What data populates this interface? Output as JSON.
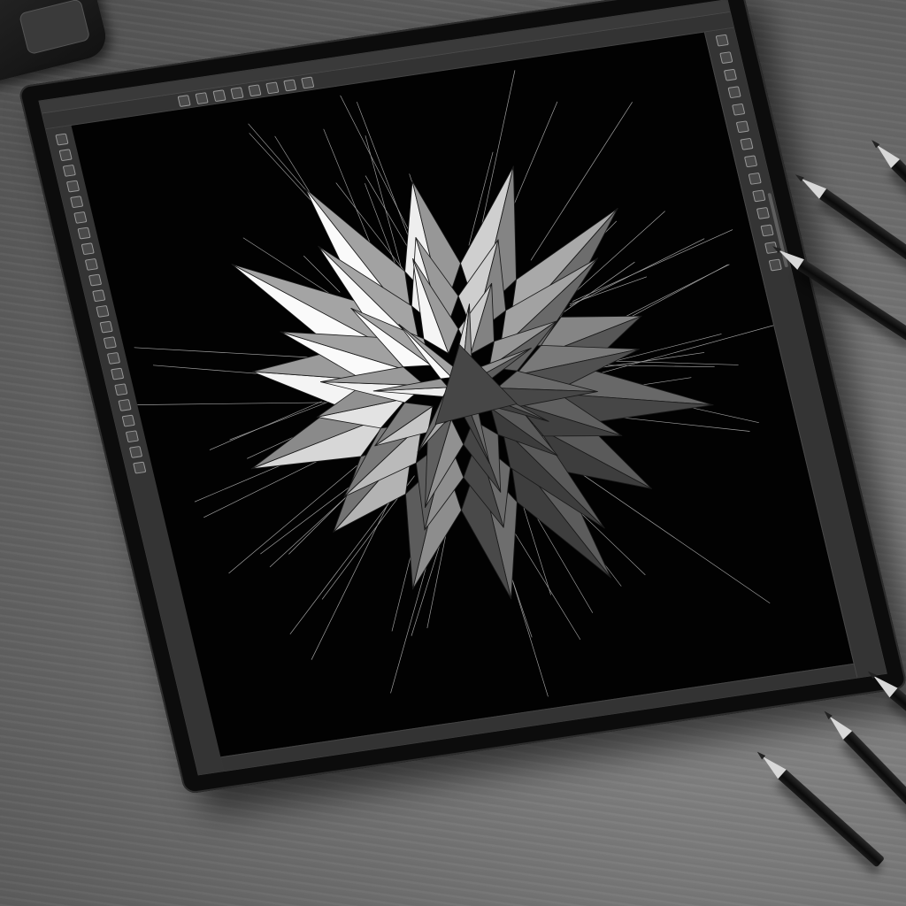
{
  "app": {
    "menubar_text": "",
    "toolbar_count": 22,
    "panel_count": 14
  },
  "artwork": {
    "subject": "",
    "palette": {
      "background": "#000000",
      "highlight": "#f2f2f2",
      "shadow": "#3a3a3a",
      "desk": "#6e6e6e"
    }
  },
  "icons": {
    "tool": "tool-icon",
    "panel": "panel-icon",
    "pencil": "pencil-icon"
  }
}
